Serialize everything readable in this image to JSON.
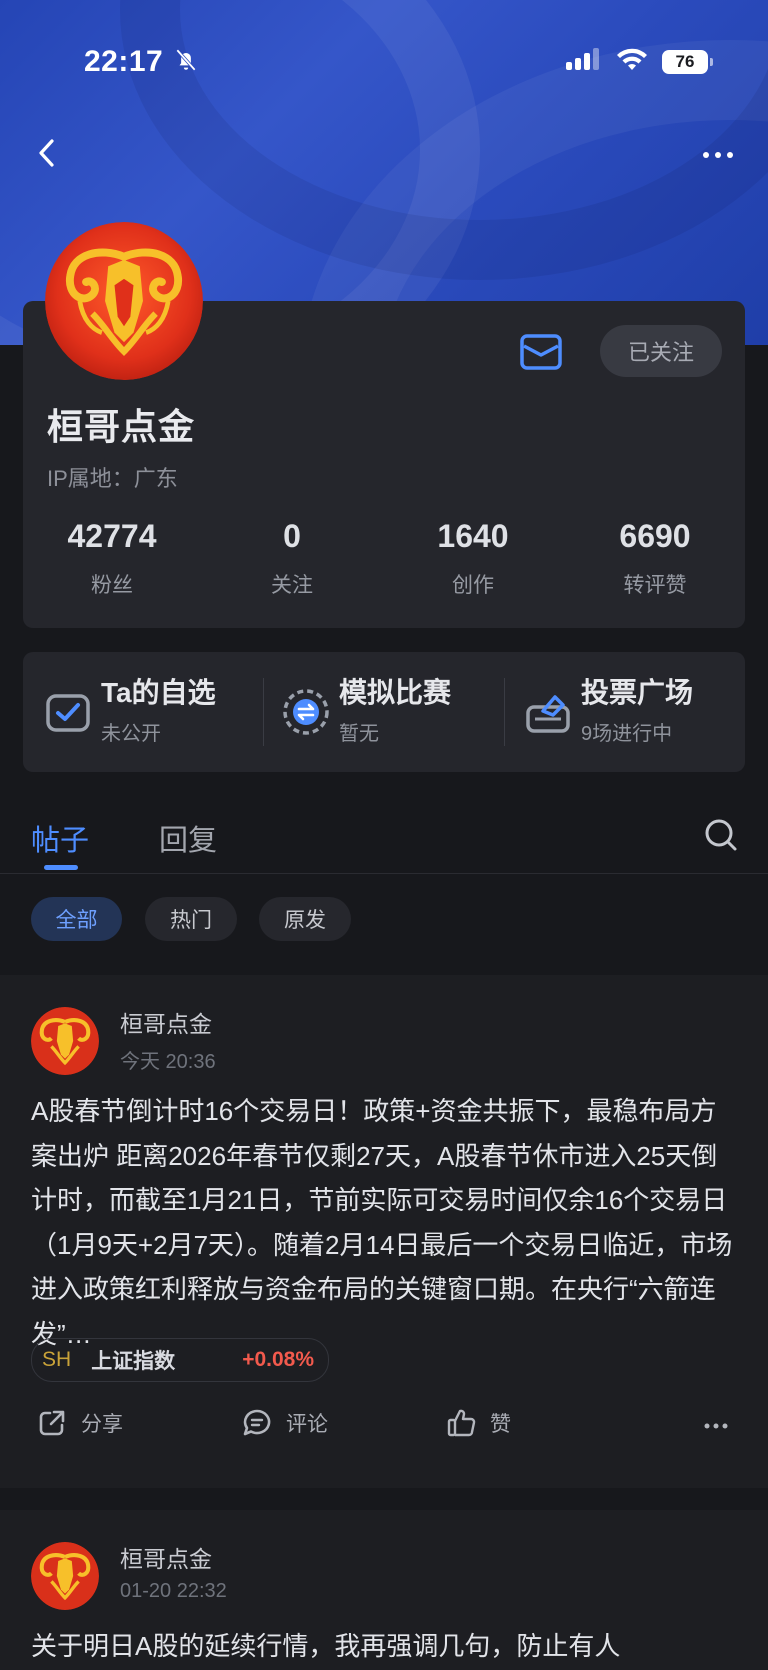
{
  "status_bar": {
    "time": "22:17",
    "battery": "76"
  },
  "header": {
    "back_icon": "chevron-left-icon",
    "more_icon": "more-horizontal-icon"
  },
  "profile": {
    "name": "桓哥点金",
    "ip_location": "IP属地：广东",
    "follow_button": "已关注",
    "mail_icon": "mail-icon",
    "stats": [
      {
        "value": "42774",
        "label": "粉丝"
      },
      {
        "value": "0",
        "label": "关注"
      },
      {
        "value": "1640",
        "label": "创作"
      },
      {
        "value": "6690",
        "label": "转评赞"
      }
    ]
  },
  "features": [
    {
      "title": "Ta的自选",
      "subtitle": "未公开",
      "icon": "watchlist-check-icon"
    },
    {
      "title": "模拟比赛",
      "subtitle": "暂无",
      "icon": "exchange-arrows-icon"
    },
    {
      "title": "投票广场",
      "subtitle": "9场进行中",
      "icon": "vote-box-icon"
    }
  ],
  "tabs": [
    {
      "label": "帖子"
    },
    {
      "label": "回复"
    }
  ],
  "filters": [
    {
      "label": "全部"
    },
    {
      "label": "热门"
    },
    {
      "label": "原发"
    }
  ],
  "posts": [
    {
      "author": "桓哥点金",
      "time": "今天 20:36",
      "body": "A股春节倒计时16个交易日！政策+资金共振下，最稳布局方案出炉 距离2026年春节仅剩27天，A股春节休市进入25天倒计时，而截至1月21日，节前实际可交易时间仅余16个交易日（1月9天+2月7天）。随着2月14日最后一个交易日临近，市场进入政策红利释放与资金布局的关键窗口期。在央行“六箭连发”…",
      "stock": {
        "symbol": "SH",
        "name": "上证指数",
        "change": "+0.08%"
      },
      "actions": {
        "share": "分享",
        "comment": "评论",
        "like": "赞"
      }
    },
    {
      "author": "桓哥点金",
      "time": "01-20 22:32",
      "body": "关于明日A股的延续行情，我再强调几句，防止有人"
    }
  ],
  "colors": {
    "accent": "#4e8dff",
    "up": "#f25a4d",
    "hero": "#2b4bbd"
  }
}
